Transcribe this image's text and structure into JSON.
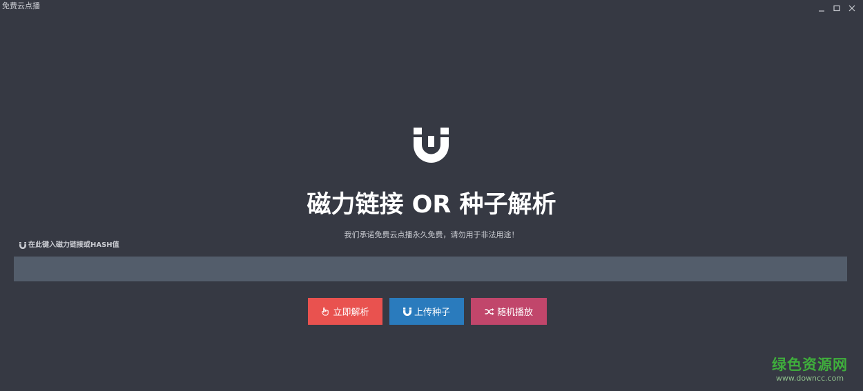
{
  "window": {
    "title": "免费云点播"
  },
  "logo": {
    "icon": "magnet-logo-icon"
  },
  "main": {
    "headline": "磁力链接 OR 种子解析",
    "subtitle": "我们承诺免费云点播永久免费，请勿用于非法用途！",
    "input_label": "在此键入磁力链接或HASH值",
    "input_value": "",
    "input_placeholder": ""
  },
  "buttons": {
    "parse": "立即解析",
    "upload": "上传种子",
    "random": "随机播放"
  },
  "watermark": {
    "name": "绿色资源网",
    "url": "www.downcc.com"
  },
  "colors": {
    "background": "#363943",
    "input_bg": "#535d6b",
    "parse_button": "#e9524f",
    "upload_button": "#2a7bbd",
    "random_button": "#c1466b"
  }
}
